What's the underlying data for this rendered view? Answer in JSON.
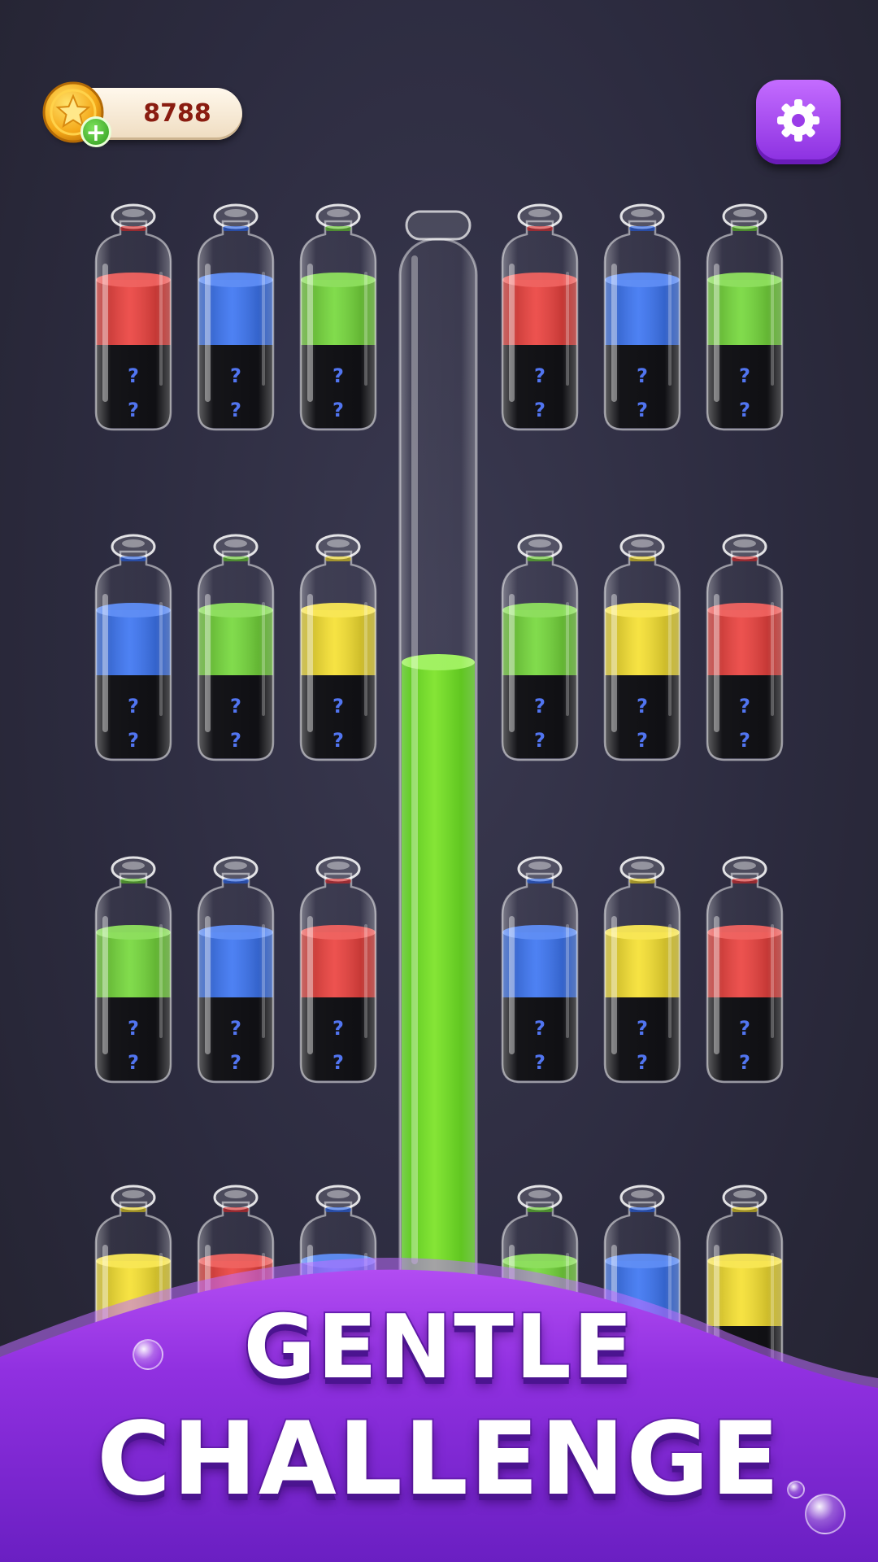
{
  "coins": {
    "count": "8788",
    "coin_icon": "gold-star-coin",
    "add_icon": "plus"
  },
  "settings": {
    "icon": "gear-icon"
  },
  "colors": {
    "red": "#e8231f",
    "blue": "#1d5ff0",
    "green": "#5fd21c",
    "yellow": "#f5dc10",
    "hidden": "#08080c",
    "mark": "#4a6ff0"
  },
  "hidden_mark": "?",
  "bottles": [
    {
      "row": 1,
      "col": 1,
      "top": "red",
      "hidden": 2
    },
    {
      "row": 1,
      "col": 2,
      "top": "blue",
      "hidden": 2
    },
    {
      "row": 1,
      "col": 3,
      "top": "green",
      "hidden": 2
    },
    {
      "row": 1,
      "col": 4,
      "top": "red",
      "hidden": 2
    },
    {
      "row": 1,
      "col": 5,
      "top": "blue",
      "hidden": 2
    },
    {
      "row": 1,
      "col": 6,
      "top": "green",
      "hidden": 2
    },
    {
      "row": 2,
      "col": 1,
      "top": "blue",
      "hidden": 2
    },
    {
      "row": 2,
      "col": 2,
      "top": "green",
      "hidden": 2
    },
    {
      "row": 2,
      "col": 3,
      "top": "yellow",
      "hidden": 2
    },
    {
      "row": 2,
      "col": 4,
      "top": "green",
      "hidden": 2
    },
    {
      "row": 2,
      "col": 5,
      "top": "yellow",
      "hidden": 2
    },
    {
      "row": 2,
      "col": 6,
      "top": "red",
      "hidden": 2
    },
    {
      "row": 3,
      "col": 1,
      "top": "green",
      "hidden": 2
    },
    {
      "row": 3,
      "col": 2,
      "top": "blue",
      "hidden": 2
    },
    {
      "row": 3,
      "col": 3,
      "top": "red",
      "hidden": 2
    },
    {
      "row": 3,
      "col": 4,
      "top": "blue",
      "hidden": 2
    },
    {
      "row": 3,
      "col": 5,
      "top": "yellow",
      "hidden": 2
    },
    {
      "row": 3,
      "col": 6,
      "top": "red",
      "hidden": 2
    },
    {
      "row": 4,
      "col": 1,
      "top": "yellow",
      "hidden": 2
    },
    {
      "row": 4,
      "col": 2,
      "top": "red",
      "hidden": 2
    },
    {
      "row": 4,
      "col": 3,
      "top": "blue",
      "hidden": 2
    },
    {
      "row": 4,
      "col": 4,
      "top": "green",
      "hidden": 2
    },
    {
      "row": 4,
      "col": 5,
      "top": "blue",
      "hidden": 2
    },
    {
      "row": 4,
      "col": 6,
      "top": "yellow",
      "hidden": 2
    }
  ],
  "tube": {
    "liquid": "green",
    "fill_fraction": 0.6
  },
  "banner": {
    "line1": "GENTLE",
    "line2": "CHALLENGE"
  }
}
